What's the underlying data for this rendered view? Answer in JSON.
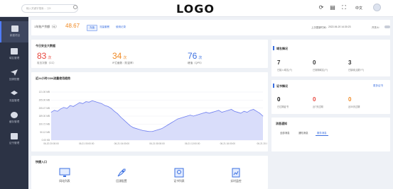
{
  "header": {
    "search_placeholder": "输入关键字搜索…  ⌘K",
    "logo": "LOGO",
    "lang": "中文"
  },
  "sidebar": {
    "items": [
      {
        "label": "新建项目"
      },
      {
        "label": "域名管理"
      },
      {
        "label": "回源配置"
      },
      {
        "label": "流量管理"
      },
      {
        "label": "缓存管理"
      },
      {
        "label": "证书管理"
      }
    ]
  },
  "traffic": {
    "label": "1年账户余额（元）",
    "value": "48.67",
    "tags": [
      "充值",
      "流量套餐",
      "使用记录"
    ],
    "update_label": "上次更新时间：",
    "update_time": "2022-06-20 14:30:23",
    "toggle_label": "开关/Li"
  },
  "today": {
    "title": "今日安全大数据",
    "stats": [
      {
        "value": "83",
        "unit": "次",
        "label": "攻击次数（CC）",
        "color": "#e8453c"
      },
      {
        "value": "34",
        "unit": "次",
        "label": "IP拦截数（防盗率）",
        "color": "#f08a24"
      },
      {
        "value": "76",
        "unit": "次",
        "label": "峰值（QPS）",
        "color": "#3b6fe0"
      }
    ]
  },
  "chart_data": {
    "type": "area",
    "title": "近24小时CDN流量使用趋势",
    "xlabel": "",
    "ylabel": "",
    "y_ticks": [
      "121.00 MB",
      "205.00 MB",
      "205.47 MB",
      "189.00 MB",
      "100.72 MB",
      "50.12 MB",
      "0.00 KB"
    ],
    "x_ticks": [
      "06-20 20:00:00",
      "06-21 00:00:00",
      "06-21 04:00:00",
      "06-21 08:00:00",
      "06-21 12:00:00",
      "06-21 16:00:00",
      "06-21 20:00"
    ],
    "ylim": [
      0,
      1
    ],
    "color": "#6f7ff0",
    "fill": "#d9ddfa",
    "values": [
      0.58,
      0.62,
      0.6,
      0.65,
      0.68,
      0.66,
      0.72,
      0.7,
      0.74,
      0.78,
      0.76,
      0.8,
      0.79,
      0.82,
      0.8,
      0.78,
      0.76,
      0.72,
      0.7,
      0.66,
      0.6,
      0.55,
      0.48,
      0.42,
      0.36,
      0.3,
      0.26,
      0.24,
      0.22,
      0.2,
      0.19,
      0.18,
      0.18,
      0.2,
      0.22,
      0.24,
      0.28,
      0.32,
      0.36,
      0.4,
      0.44,
      0.46,
      0.48,
      0.5,
      0.52,
      0.5,
      0.52,
      0.54,
      0.56,
      0.58,
      0.56,
      0.58,
      0.6,
      0.62,
      0.58,
      0.6,
      0.62,
      0.64,
      0.6,
      0.58,
      0.56,
      0.6,
      0.58,
      0.62,
      0.64,
      0.6,
      0.56,
      0.5
    ]
  },
  "quick_entry": {
    "title": "快捷入口",
    "items": [
      {
        "label": "网站列表"
      },
      {
        "label": "回源配置"
      },
      {
        "label": "证书列表"
      },
      {
        "label": "实时监控"
      }
    ]
  },
  "domains": {
    "title": "域名情况",
    "stats": [
      {
        "value": "7",
        "label": "已接入域名(个)"
      },
      {
        "value": "0",
        "label": "已到期域名(个)"
      },
      {
        "value": "3",
        "label": "已接收(活跃/个)"
      }
    ]
  },
  "certs": {
    "title": "证书情况",
    "link": "更多证书",
    "stats": [
      {
        "value": "0",
        "label": "已过期证书",
        "color": "#111111"
      },
      {
        "value": "0",
        "label": "近7天过期",
        "color": "#e8453c"
      },
      {
        "value": "0",
        "label": "近30天过期",
        "color": "#f08a24"
      }
    ]
  },
  "notices": {
    "title": "消息通知",
    "tabs": [
      "全部消息",
      "通知消息",
      "服务消息"
    ]
  }
}
